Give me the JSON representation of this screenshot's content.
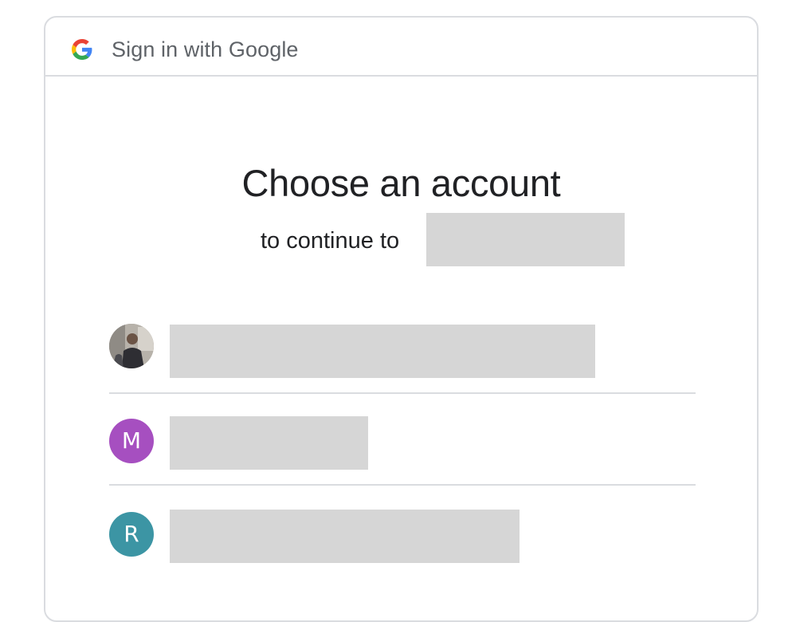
{
  "header": {
    "title": "Sign in with Google",
    "logo_icon": "google-g-icon"
  },
  "main": {
    "heading": "Choose an account",
    "subtitle": "to continue to",
    "app_name_redacted": true
  },
  "accounts": [
    {
      "avatar_type": "photo",
      "initial": "",
      "avatar_color": "#a9a39b",
      "redacted": true
    },
    {
      "avatar_type": "letter",
      "initial": "M",
      "avatar_color": "#a64fc0",
      "redacted": true
    },
    {
      "avatar_type": "letter",
      "initial": "R",
      "avatar_color": "#3c95a4",
      "redacted": true
    }
  ],
  "colors": {
    "border": "#dadce0",
    "header_text": "#5f6368",
    "body_text": "#202124",
    "redaction": "#d6d6d6",
    "google_blue": "#4285F4",
    "google_red": "#EA4335",
    "google_yellow": "#FBBC05",
    "google_green": "#34A853"
  }
}
